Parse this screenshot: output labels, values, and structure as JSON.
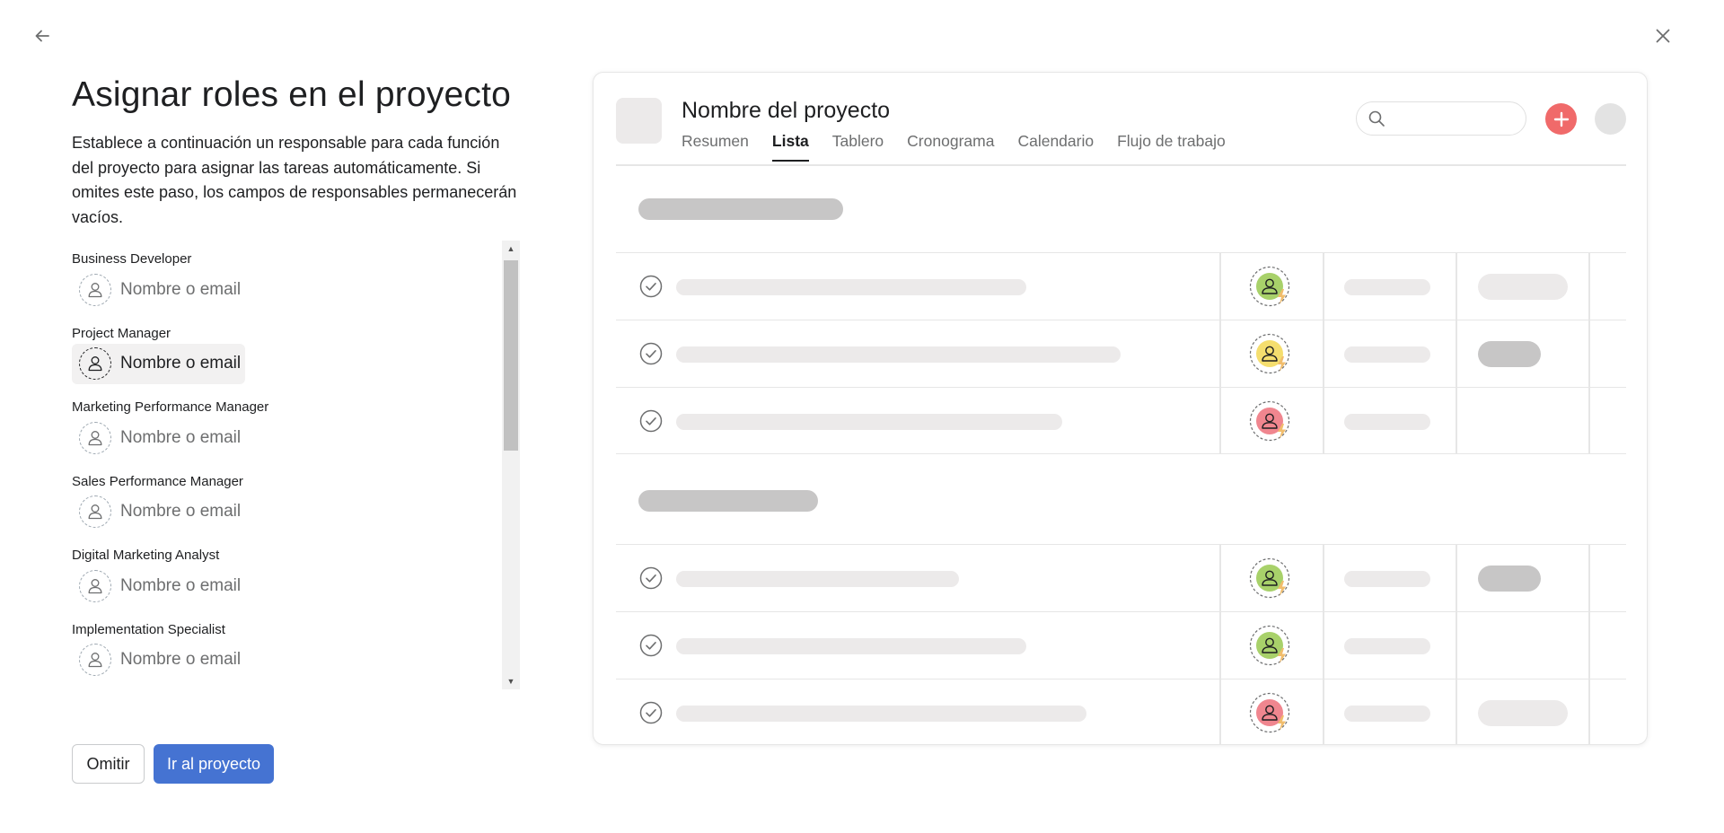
{
  "header": {
    "title": "Asignar roles en el proyecto",
    "description": "Establece a continuación un responsable para cada función del proyecto para asignar las tareas automáticamente. Si omites este paso, los campos de responsables permanecerán vacíos."
  },
  "roles": [
    {
      "label": "Business Developer",
      "placeholder": "Nombre o email"
    },
    {
      "label": "Project Manager",
      "placeholder": "Nombre o email"
    },
    {
      "label": "Marketing Performance Manager",
      "placeholder": "Nombre o email"
    },
    {
      "label": "Sales Performance Manager",
      "placeholder": "Nombre o email"
    },
    {
      "label": "Digital Marketing Analyst",
      "placeholder": "Nombre o email"
    },
    {
      "label": "Implementation Specialist",
      "placeholder": "Nombre o email"
    }
  ],
  "actions": {
    "skip_label": "Omitir",
    "go_label": "Ir al proyecto"
  },
  "preview": {
    "project_name": "Nombre del proyecto",
    "tabs": [
      "Resumen",
      "Lista",
      "Tablero",
      "Cronograma",
      "Calendario",
      "Flujo de trabajo"
    ],
    "active_tab": "Lista",
    "rows": [
      {
        "avatar_color": "#a8d16a",
        "tag": "light"
      },
      {
        "avatar_color": "#f5de6e",
        "tag": "dark"
      },
      {
        "avatar_color": "#f0868f",
        "tag": "none"
      },
      {
        "avatar_color": "#a8d16a",
        "tag": "dark"
      },
      {
        "avatar_color": "#a8d16a",
        "tag": "none"
      },
      {
        "avatar_color": "#f0868f",
        "tag": "light"
      }
    ]
  },
  "icons": {
    "back": "arrow-left-icon",
    "close": "close-icon",
    "search": "search-icon",
    "add": "plus-icon",
    "check": "check-circle-icon",
    "user": "user-icon",
    "rule": "lightning-icon"
  },
  "colors": {
    "primary_button": "#4573d2",
    "add_button": "#f06a6a",
    "rule_bolt": "#f1bd6c"
  }
}
